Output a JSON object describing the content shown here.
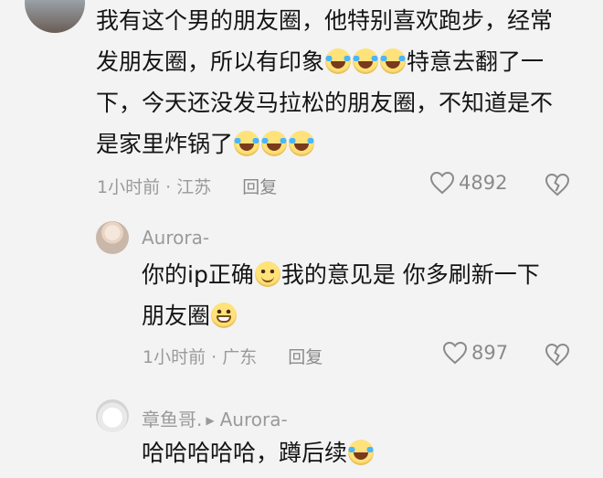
{
  "comments": [
    {
      "lines": [
        {
          "text": "我有这个男的朋友圈，他特别喜欢跑步，经常"
        },
        {
          "text": "发朋友圈，所以有印象",
          "emojis": [
            "laugh",
            "laugh",
            "laugh"
          ],
          "after": "特意去翻了一"
        },
        {
          "text": "下，今天还没发马拉松的朋友圈，不知道是不"
        },
        {
          "text": "是家里炸锅了",
          "emojis": [
            "laugh",
            "laugh",
            "laugh"
          ],
          "after": ""
        }
      ],
      "time": "1小时前 · 江苏",
      "reply": "回复",
      "likes": "4892"
    },
    {
      "author": "Aurora-",
      "lines": [
        {
          "text": "你的ip正确",
          "emojis": [
            "smile"
          ],
          "after": "我的意见是 你多刷新一下"
        },
        {
          "text": "朋友圈",
          "emojis": [
            "grin"
          ],
          "after": ""
        }
      ],
      "time": "1小时前 · 广东",
      "reply": "回复",
      "likes": "897"
    },
    {
      "author": "章鱼哥.",
      "reply_to": "Aurora-",
      "lines": [
        {
          "text": "哈哈哈哈哈，蹲后续",
          "emojis": [
            "laugh"
          ],
          "after": ""
        }
      ]
    }
  ],
  "icons": {
    "like": "heart-outline-icon",
    "dislike": "broken-heart-icon"
  },
  "colors": {
    "background": "#f3f3f3",
    "text": "#141414",
    "meta": "#9a9a9a"
  }
}
